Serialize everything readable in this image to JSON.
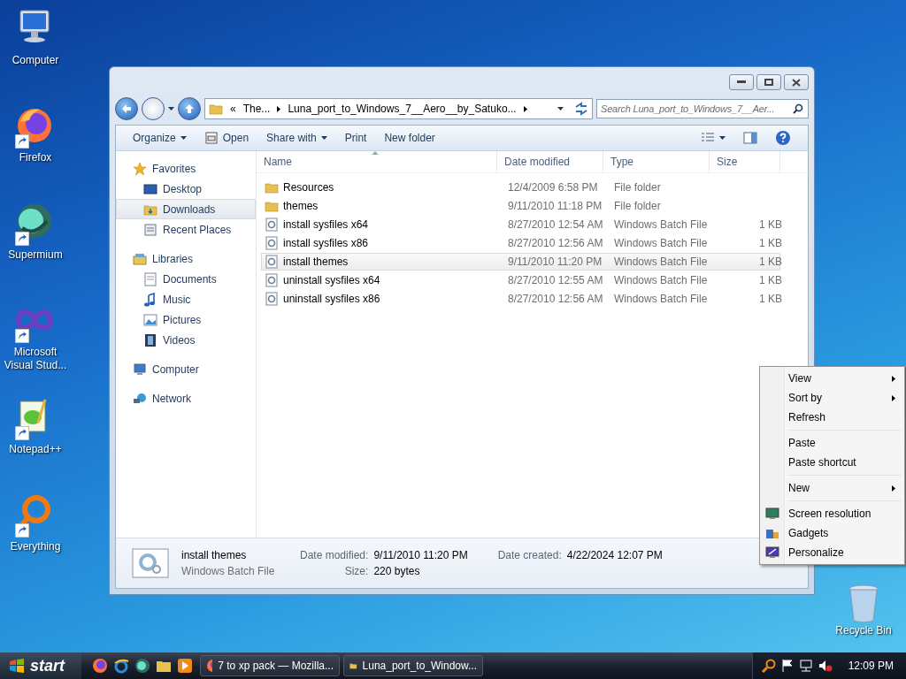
{
  "desktop_icons": [
    {
      "label": "Computer",
      "kind": "computer",
      "shortcut": false
    },
    {
      "label": "Firefox",
      "kind": "firefox",
      "shortcut": true
    },
    {
      "label": "Supermium",
      "kind": "supermium",
      "shortcut": true
    },
    {
      "label": "Microsoft Visual Stud...",
      "kind": "studio",
      "shortcut": true
    },
    {
      "label": "Notepad++",
      "kind": "notepad",
      "shortcut": true
    },
    {
      "label": "Everything",
      "kind": "everything",
      "shortcut": true
    }
  ],
  "recycle_bin": {
    "label": "Recycle Bin"
  },
  "window": {
    "address": {
      "overflow": "«",
      "crumbs": [
        "The...",
        "Luna_port_to_Windows_7__Aero__by_Satuko..."
      ]
    },
    "search": {
      "placeholder": "Search Luna_port_to_Windows_7__Aer..."
    },
    "toolbar": [
      {
        "label": "Organize",
        "kind": "menu"
      },
      {
        "label": "Open",
        "kind": "open"
      },
      {
        "label": "Share with",
        "kind": "menu"
      },
      {
        "label": "Print",
        "kind": "plain"
      },
      {
        "label": "New folder",
        "kind": "plain"
      }
    ],
    "nav": [
      {
        "label": "Favorites",
        "kind": "star",
        "children": [
          {
            "label": "Desktop",
            "kind": "desktop",
            "selected": false
          },
          {
            "label": "Downloads",
            "kind": "downloads",
            "selected": true
          },
          {
            "label": "Recent Places",
            "kind": "recent",
            "selected": false
          }
        ]
      },
      {
        "label": "Libraries",
        "kind": "libraries",
        "children": [
          {
            "label": "Documents",
            "kind": "documents",
            "selected": false
          },
          {
            "label": "Music",
            "kind": "music",
            "selected": false
          },
          {
            "label": "Pictures",
            "kind": "pictures",
            "selected": false
          },
          {
            "label": "Videos",
            "kind": "videos",
            "selected": false
          }
        ]
      },
      {
        "label": "Computer",
        "kind": "computer"
      },
      {
        "label": "Network",
        "kind": "network"
      }
    ],
    "columns": [
      "Name",
      "Date modified",
      "Type",
      "Size"
    ],
    "files": [
      {
        "name": "Resources",
        "date": "12/4/2009 6:58 PM",
        "type": "File folder",
        "kind": "folder",
        "selected": false
      },
      {
        "name": "themes",
        "date": "9/11/2010 11:18 PM",
        "type": "File folder",
        "kind": "folder",
        "selected": false
      },
      {
        "name": "install sysfiles x64",
        "date": "8/27/2010 12:54 AM",
        "type": "Windows Batch File",
        "size": "1 KB",
        "kind": "batch",
        "selected": false
      },
      {
        "name": "install sysfiles x86",
        "date": "8/27/2010 12:56 AM",
        "type": "Windows Batch File",
        "size": "1 KB",
        "kind": "batch",
        "selected": false
      },
      {
        "name": "install themes",
        "date": "9/11/2010 11:20 PM",
        "type": "Windows Batch File",
        "size": "1 KB",
        "kind": "batch",
        "selected": true
      },
      {
        "name": "uninstall sysfiles x64",
        "date": "8/27/2010 12:55 AM",
        "type": "Windows Batch File",
        "size": "1 KB",
        "kind": "batch",
        "selected": false
      },
      {
        "name": "uninstall sysfiles x86",
        "date": "8/27/2010 12:56 AM",
        "type": "Windows Batch File",
        "size": "1 KB",
        "kind": "batch",
        "selected": false
      }
    ],
    "details": {
      "name": "install themes",
      "type": "Windows Batch File",
      "fields": [
        {
          "label": "Date modified:",
          "value": "9/11/2010 11:20 PM"
        },
        {
          "label": "Date created:",
          "value": "4/22/2024 12:07 PM"
        },
        {
          "label": "Size:",
          "value": "220 bytes"
        }
      ]
    }
  },
  "context_menu": [
    [
      {
        "label": "View",
        "submenu": true,
        "kind": "plain"
      },
      {
        "label": "Sort by",
        "submenu": true,
        "kind": "plain"
      },
      {
        "label": "Refresh",
        "submenu": false,
        "kind": "plain"
      }
    ],
    [
      {
        "label": "Paste",
        "submenu": false,
        "kind": "plain"
      },
      {
        "label": "Paste shortcut",
        "submenu": false,
        "kind": "plain"
      }
    ],
    [
      {
        "label": "New",
        "submenu": true,
        "kind": "plain"
      }
    ],
    [
      {
        "label": "Screen resolution",
        "submenu": false,
        "kind": "display"
      },
      {
        "label": "Gadgets",
        "submenu": false,
        "kind": "gadgets"
      },
      {
        "label": "Personalize",
        "submenu": false,
        "kind": "personalize"
      }
    ]
  ],
  "taskbar": {
    "start": "start",
    "tasks": [
      {
        "label": "7 to xp pack — Mozilla...",
        "kind": "firefox",
        "selected": false
      },
      {
        "label": "Luna_port_to_Window...",
        "kind": "folder",
        "selected": false
      }
    ],
    "clock": "12:09 PM"
  }
}
